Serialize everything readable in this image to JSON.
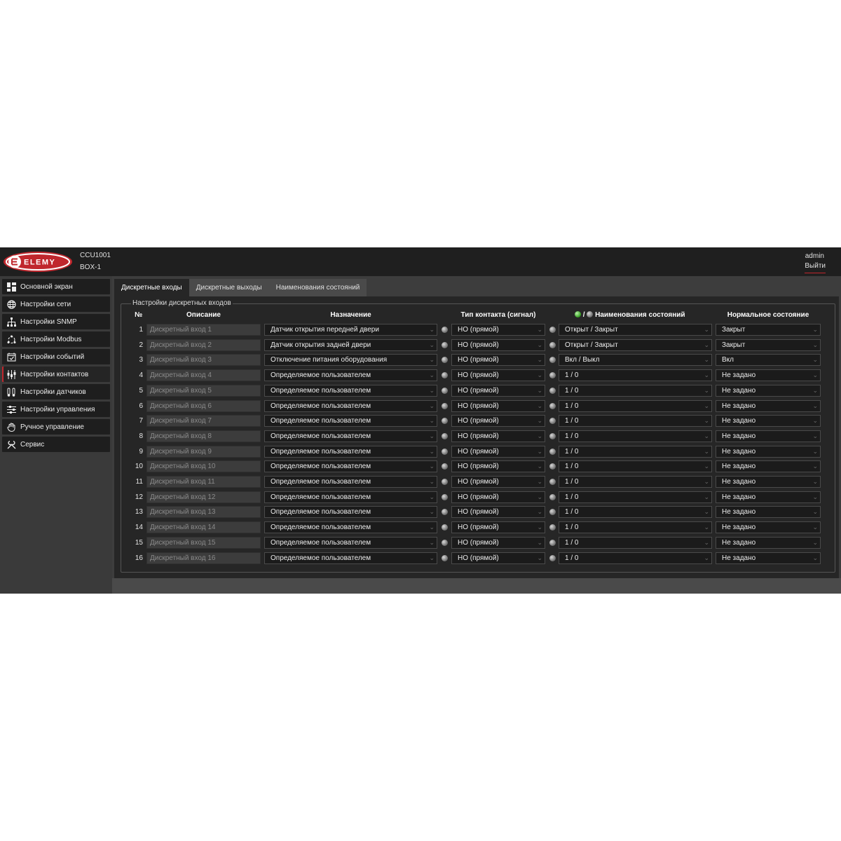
{
  "header": {
    "brand": "ELEMY",
    "device_model": "CCU1001",
    "device_name": "BOX-1",
    "user": "admin",
    "logout_label": "Выйти"
  },
  "sidebar": {
    "items": [
      {
        "label": "Основной экран",
        "icon": "dashboard-icon"
      },
      {
        "label": "Настройки сети",
        "icon": "globe-icon"
      },
      {
        "label": "Настройки SNMP",
        "icon": "network-tree-icon"
      },
      {
        "label": "Настройки Modbus",
        "icon": "modbus-icon"
      },
      {
        "label": "Настройки событий",
        "icon": "calendar-check-icon"
      },
      {
        "label": "Настройки контактов",
        "icon": "contacts-icon",
        "active": true
      },
      {
        "label": "Настройки датчиков",
        "icon": "sensor-icon"
      },
      {
        "label": "Настройки управления",
        "icon": "sliders-icon"
      },
      {
        "label": "Ручное управление",
        "icon": "hand-icon"
      },
      {
        "label": "Сервис",
        "icon": "tools-icon"
      }
    ]
  },
  "tabs": [
    {
      "label": "Дискретные входы",
      "active": true
    },
    {
      "label": "Дискретные выходы"
    },
    {
      "label": "Наименования состояний"
    }
  ],
  "panel": {
    "legend": "Настройки дискретных входов",
    "columns": {
      "num": "№",
      "description": "Описание",
      "purpose": "Назначение",
      "contact_type": "Тип контакта (сигнал)",
      "state_sep": "/",
      "state_names": "Наименования состояний",
      "normal_state": "Нормальное состояние"
    },
    "rows": [
      {
        "n": "1",
        "desc": "Дискретный вход 1",
        "purpose": "Датчик открытия передней двери",
        "type": "НО (прямой)",
        "states": "Открыт / Закрыт",
        "normal": "Закрыт"
      },
      {
        "n": "2",
        "desc": "Дискретный вход 2",
        "purpose": "Датчик открытия задней двери",
        "type": "НО (прямой)",
        "states": "Открыт / Закрыт",
        "normal": "Закрыт"
      },
      {
        "n": "3",
        "desc": "Дискретный вход 3",
        "purpose": "Отключение питания оборудования",
        "type": "НО (прямой)",
        "states": "Вкл / Выкл",
        "normal": "Вкл"
      },
      {
        "n": "4",
        "desc": "Дискретный вход 4",
        "purpose": "Определяемое пользователем",
        "type": "НО (прямой)",
        "states": "1 / 0",
        "normal": "Не задано"
      },
      {
        "n": "5",
        "desc": "Дискретный вход 5",
        "purpose": "Определяемое пользователем",
        "type": "НО (прямой)",
        "states": "1 / 0",
        "normal": "Не задано"
      },
      {
        "n": "6",
        "desc": "Дискретный вход 6",
        "purpose": "Определяемое пользователем",
        "type": "НО (прямой)",
        "states": "1 / 0",
        "normal": "Не задано"
      },
      {
        "n": "7",
        "desc": "Дискретный вход 7",
        "purpose": "Определяемое пользователем",
        "type": "НО (прямой)",
        "states": "1 / 0",
        "normal": "Не задано"
      },
      {
        "n": "8",
        "desc": "Дискретный вход 8",
        "purpose": "Определяемое пользователем",
        "type": "НО (прямой)",
        "states": "1 / 0",
        "normal": "Не задано"
      },
      {
        "n": "9",
        "desc": "Дискретный вход 9",
        "purpose": "Определяемое пользователем",
        "type": "НО (прямой)",
        "states": "1 / 0",
        "normal": "Не задано"
      },
      {
        "n": "10",
        "desc": "Дискретный вход 10",
        "purpose": "Определяемое пользователем",
        "type": "НО (прямой)",
        "states": "1 / 0",
        "normal": "Не задано"
      },
      {
        "n": "11",
        "desc": "Дискретный вход 11",
        "purpose": "Определяемое пользователем",
        "type": "НО (прямой)",
        "states": "1 / 0",
        "normal": "Не задано"
      },
      {
        "n": "12",
        "desc": "Дискретный вход 12",
        "purpose": "Определяемое пользователем",
        "type": "НО (прямой)",
        "states": "1 / 0",
        "normal": "Не задано"
      },
      {
        "n": "13",
        "desc": "Дискретный вход 13",
        "purpose": "Определяемое пользователем",
        "type": "НО (прямой)",
        "states": "1 / 0",
        "normal": "Не задано"
      },
      {
        "n": "14",
        "desc": "Дискретный вход 14",
        "purpose": "Определяемое пользователем",
        "type": "НО (прямой)",
        "states": "1 / 0",
        "normal": "Не задано"
      },
      {
        "n": "15",
        "desc": "Дискретный вход 15",
        "purpose": "Определяемое пользователем",
        "type": "НО (прямой)",
        "states": "1 / 0",
        "normal": "Не задано"
      },
      {
        "n": "16",
        "desc": "Дискретный вход 16",
        "purpose": "Определяемое пользователем",
        "type": "НО (прямой)",
        "states": "1 / 0",
        "normal": "Не задано"
      }
    ]
  },
  "colors": {
    "brand_red": "#c0272d",
    "header_bg": "#1f1f1f",
    "panel_bg": "#262626",
    "led_green": "#2f9b1c",
    "led_gray": "#8a8a8a"
  }
}
